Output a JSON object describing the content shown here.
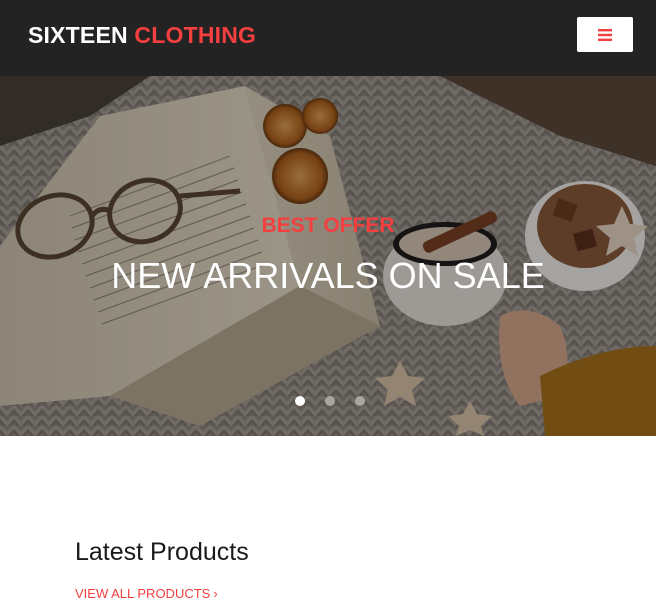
{
  "header": {
    "brand_primary": "SIXTEEN",
    "brand_accent": "CLOTHING",
    "menu_icon": "hamburger-icon",
    "accent_color": "#f33f3f",
    "background_color": "#232323"
  },
  "hero": {
    "kicker": "BEST OFFER",
    "title": "NEW ARRIVALS ON SALE",
    "slides_total": 3,
    "active_slide": 1
  },
  "latest": {
    "title": "Latest Products",
    "view_all_label": "VIEW ALL PRODUCTS",
    "view_all_icon": "chevron-right-icon"
  }
}
